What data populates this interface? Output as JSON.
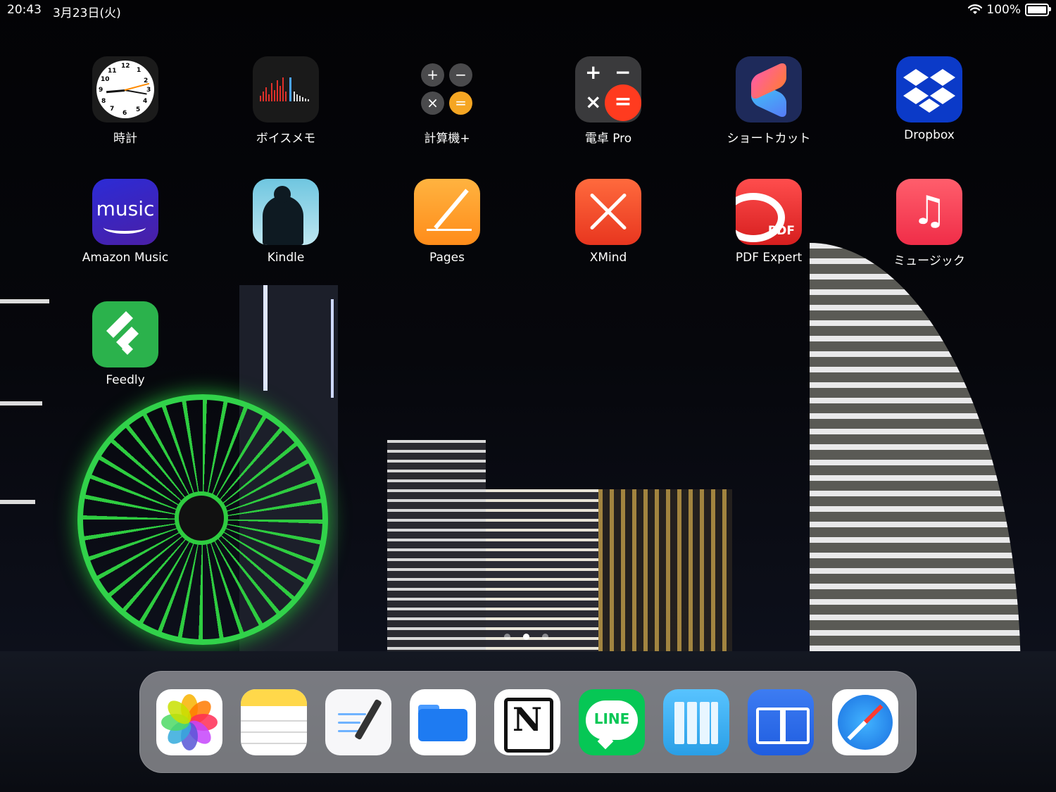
{
  "status_bar": {
    "time": "20:43",
    "date": "3月23日(火)",
    "battery": "100%"
  },
  "apps": {
    "clock": "時計",
    "voice_memo": "ボイスメモ",
    "calculator_plus": "計算機+",
    "calculator_pro": "電卓 Pro",
    "shortcuts": "ショートカット",
    "dropbox": "Dropbox",
    "amazon_music": "Amazon Music",
    "kindle": "Kindle",
    "pages": "Pages",
    "xmind": "XMind",
    "pdf_expert": "PDF Expert",
    "music": "ミュージック",
    "feedly": "Feedly"
  },
  "icon_text": {
    "amazon_music": "music",
    "pdf_expert": "PDF",
    "line": "LINE",
    "notion": "N",
    "music_note": "♫"
  },
  "page_indicator": {
    "pages": 3,
    "active": 2
  },
  "dock": [
    "Photos",
    "Notes",
    "GoodNotes",
    "Files",
    "Notion",
    "LINE",
    "Library",
    "Books",
    "Safari"
  ]
}
